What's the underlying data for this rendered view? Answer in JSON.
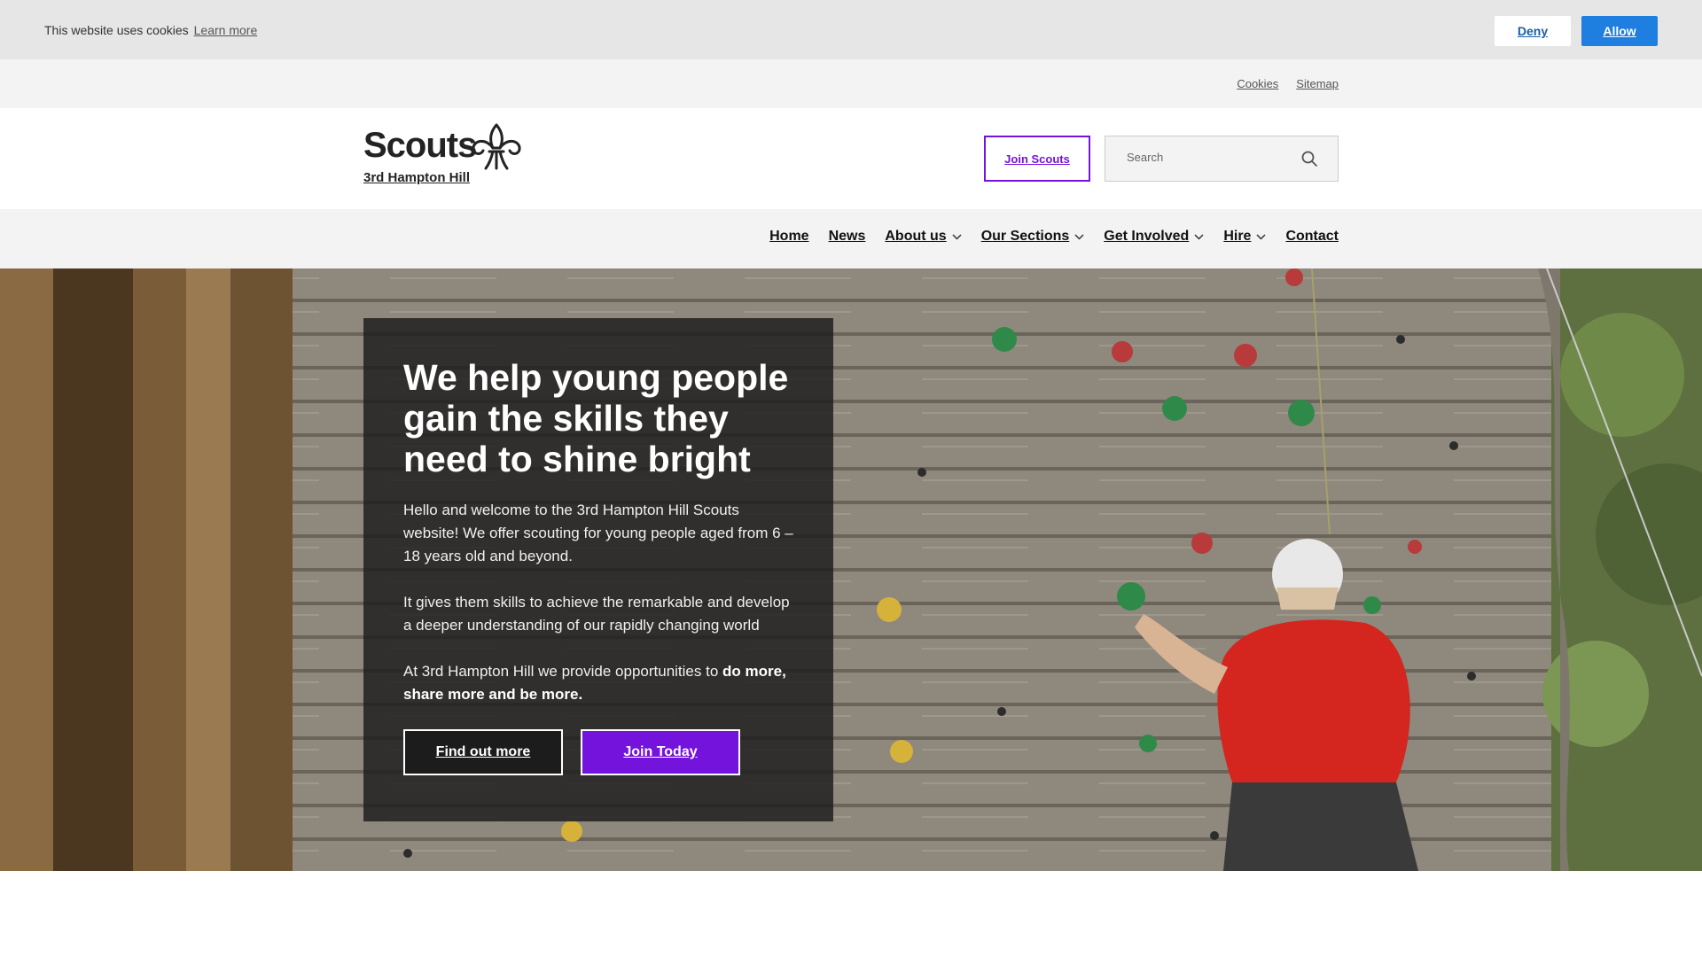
{
  "cookie": {
    "message": "This website uses cookies",
    "learn_more": "Learn more",
    "deny": "Deny",
    "allow": "Allow"
  },
  "utility": {
    "links": [
      "Cookies",
      "Sitemap"
    ]
  },
  "header": {
    "logo_word": "Scouts",
    "group_name": "3rd Hampton Hill",
    "join_button": "Join Scouts",
    "search_placeholder": "Search"
  },
  "nav": {
    "items": [
      {
        "label": "Home",
        "dropdown": false
      },
      {
        "label": "News",
        "dropdown": false
      },
      {
        "label": "About us",
        "dropdown": true
      },
      {
        "label": "Our Sections",
        "dropdown": true
      },
      {
        "label": "Get Involved",
        "dropdown": true
      },
      {
        "label": "Hire",
        "dropdown": true
      },
      {
        "label": "Contact",
        "dropdown": false
      }
    ]
  },
  "hero": {
    "title": "We help young people gain the skills they need to shine bright",
    "para1": "Hello and welcome to the 3rd Hampton Hill Scouts website! We offer scouting for young people aged from 6 – 18 years old and beyond.",
    "para2": "It gives them skills to achieve the remarkable and develop a deeper understanding of our rapidly changing world",
    "para3_start": "At 3rd Hampton Hill we provide opportunities to ",
    "para3_bold": "do more, share more and be more.",
    "find_out_more": "Find out more",
    "join_today": "Join Today"
  },
  "colors": {
    "scouts_purple": "#7413dc",
    "allow_blue": "#1e7fe0",
    "cookie_bar": "#e6e6e6",
    "nav_bg": "#f3f3f3"
  }
}
